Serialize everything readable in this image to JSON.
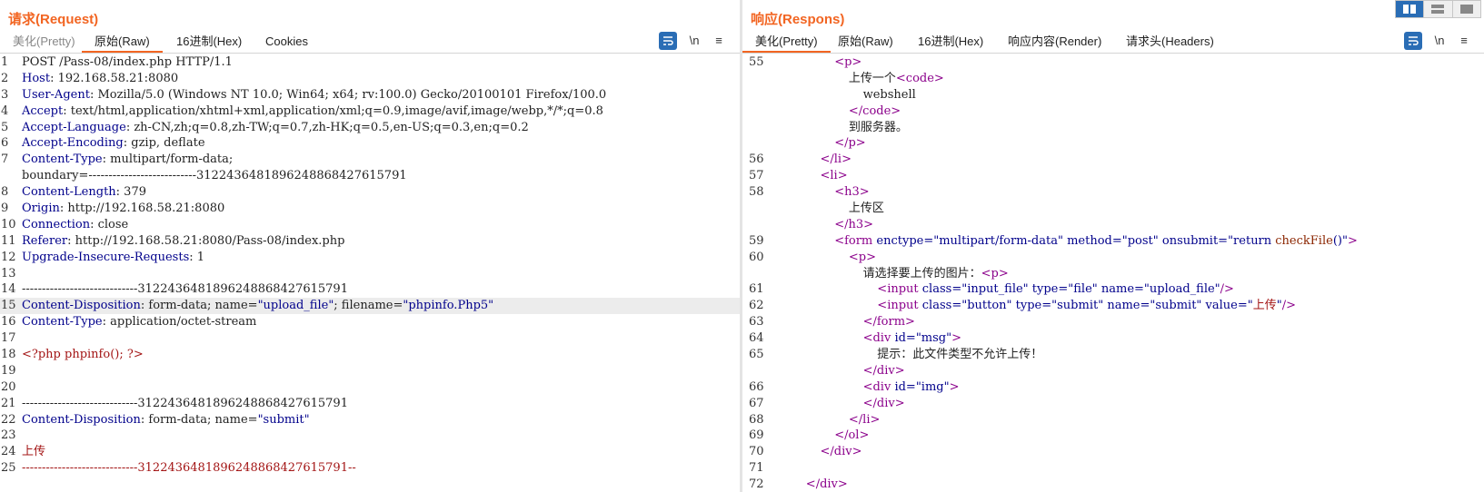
{
  "request": {
    "title": "请求(Request)",
    "tabs": [
      "美化(Pretty)",
      "原始(Raw)",
      "16进制(Hex)",
      "Cookies"
    ],
    "active_tab": "原始(Raw)",
    "newline_label": "\\n",
    "menu_label": "≡",
    "lines": [
      {
        "n": "1",
        "segs": [
          [
            "",
            "POST /Pass-08/index.php HTTP/1.1"
          ]
        ]
      },
      {
        "n": "2",
        "segs": [
          [
            "hdr",
            "Host"
          ],
          [
            "",
            ": 192.168.58.21:8080"
          ]
        ]
      },
      {
        "n": "3",
        "segs": [
          [
            "hdr",
            "User-Agent"
          ],
          [
            "",
            ": Mozilla/5.0 (Windows NT 10.0; Win64; x64; rv:100.0) Gecko/20100101 Firefox/100.0"
          ]
        ]
      },
      {
        "n": "4",
        "segs": [
          [
            "hdr",
            "Accept"
          ],
          [
            "",
            ": text/html,application/xhtml+xml,application/xml;q=0.9,image/avif,image/webp,*/*;q=0.8"
          ]
        ]
      },
      {
        "n": "5",
        "segs": [
          [
            "hdr",
            "Accept-Language"
          ],
          [
            "",
            ": zh-CN,zh;q=0.8,zh-TW;q=0.7,zh-HK;q=0.5,en-US;q=0.3,en;q=0.2"
          ]
        ]
      },
      {
        "n": "6",
        "segs": [
          [
            "hdr",
            "Accept-Encoding"
          ],
          [
            "",
            ": gzip, deflate"
          ]
        ]
      },
      {
        "n": "7",
        "segs": [
          [
            "hdr",
            "Content-Type"
          ],
          [
            "",
            ": multipart/form-data;"
          ]
        ]
      },
      {
        "n": "",
        "segs": [
          [
            "",
            "boundary=---------------------------312243648189624886842761579 1"
          ]
        ]
      },
      {
        "n": "8",
        "segs": [
          [
            "hdr",
            "Content-Length"
          ],
          [
            "",
            ": 379"
          ]
        ]
      },
      {
        "n": "9",
        "segs": [
          [
            "hdr",
            "Origin"
          ],
          [
            "",
            ": http://192.168.58.21:8080"
          ]
        ]
      },
      {
        "n": "10",
        "segs": [
          [
            "hdr",
            "Connection"
          ],
          [
            "",
            ": close"
          ]
        ]
      },
      {
        "n": "11",
        "segs": [
          [
            "hdr",
            "Referer"
          ],
          [
            "",
            ": http://192.168.58.21:8080/Pass-08/index.php"
          ]
        ]
      },
      {
        "n": "12",
        "segs": [
          [
            "hdr",
            "Upgrade-Insecure-Requests"
          ],
          [
            "",
            ": 1"
          ]
        ]
      },
      {
        "n": "13",
        "segs": []
      },
      {
        "n": "14",
        "segs": [
          [
            "",
            "-----------------------------3122436481896248868427615791"
          ]
        ]
      },
      {
        "n": "15",
        "hl": true,
        "segs": [
          [
            "hdr",
            "Content-Disposition"
          ],
          [
            "",
            ": form-data; name="
          ],
          [
            "str",
            "\"upload_file\""
          ],
          [
            "",
            "; filename="
          ],
          [
            "str",
            "\"phpinfo.Php5\""
          ]
        ]
      },
      {
        "n": "16",
        "segs": [
          [
            "hdr",
            "Content-Type"
          ],
          [
            "",
            ": application/octet-stream"
          ]
        ]
      },
      {
        "n": "17",
        "segs": []
      },
      {
        "n": "18",
        "segs": [
          [
            "red",
            "<?php phpinfo(); ?>"
          ]
        ]
      },
      {
        "n": "19",
        "segs": []
      },
      {
        "n": "20",
        "segs": []
      },
      {
        "n": "21",
        "segs": [
          [
            "",
            "-----------------------------3122436481896248868427615791"
          ]
        ]
      },
      {
        "n": "22",
        "segs": [
          [
            "hdr",
            "Content-Disposition"
          ],
          [
            "",
            ": form-data; name="
          ],
          [
            "str",
            "\"submit\""
          ]
        ]
      },
      {
        "n": "23",
        "segs": []
      },
      {
        "n": "24",
        "segs": [
          [
            "red",
            "上传"
          ]
        ]
      },
      {
        "n": "25",
        "segs": [
          [
            "red",
            "-----------------------------3122436481896248868427615791--"
          ]
        ]
      }
    ]
  },
  "response": {
    "title": "响应(Respons)",
    "tabs": [
      "美化(Pretty)",
      "原始(Raw)",
      "16进制(Hex)",
      "响应内容(Render)",
      "请求头(Headers)"
    ],
    "active_tab": "美化(Pretty)",
    "newline_label": "\\n",
    "menu_label": "≡",
    "lines": [
      {
        "n": "55",
        "i": 6,
        "segs": [
          [
            "tag",
            "<p>"
          ]
        ]
      },
      {
        "n": "",
        "i": 7,
        "segs": [
          [
            "",
            "上传一个"
          ],
          [
            "tag",
            "<code>"
          ]
        ]
      },
      {
        "n": "",
        "i": 8,
        "segs": [
          [
            "",
            "webshell"
          ]
        ]
      },
      {
        "n": "",
        "i": 7,
        "segs": [
          [
            "tag",
            "</code>"
          ]
        ]
      },
      {
        "n": "",
        "i": 7,
        "segs": [
          [
            "",
            "到服务器。"
          ]
        ]
      },
      {
        "n": "",
        "i": 6,
        "segs": [
          [
            "tag",
            "</p>"
          ]
        ]
      },
      {
        "n": "56",
        "i": 5,
        "segs": [
          [
            "tag",
            "</li>"
          ]
        ]
      },
      {
        "n": "57",
        "i": 5,
        "segs": [
          [
            "tag",
            "<li>"
          ]
        ]
      },
      {
        "n": "58",
        "i": 6,
        "segs": [
          [
            "tag",
            "<h3>"
          ]
        ]
      },
      {
        "n": "",
        "i": 7,
        "segs": [
          [
            "",
            "上传区"
          ]
        ]
      },
      {
        "n": "",
        "i": 6,
        "segs": [
          [
            "tag",
            "</h3>"
          ]
        ]
      },
      {
        "n": "59",
        "i": 6,
        "segs": [
          [
            "tag",
            "<form "
          ],
          [
            "attr",
            "enctype="
          ],
          [
            "str",
            "\"multipart/form-data\""
          ],
          [
            "attr",
            " method="
          ],
          [
            "str",
            "\"post\""
          ],
          [
            "attr",
            " onsubmit="
          ],
          [
            "str",
            "\"return "
          ],
          [
            "brown",
            "checkFile"
          ],
          [
            "str",
            "()\""
          ],
          [
            "tag",
            ">"
          ]
        ]
      },
      {
        "n": "60",
        "i": 7,
        "segs": [
          [
            "tag",
            "<p>"
          ]
        ]
      },
      {
        "n": "",
        "i": 8,
        "segs": [
          [
            "",
            "请选择要上传的图片："
          ],
          [
            "tag",
            "<p>"
          ]
        ]
      },
      {
        "n": "61",
        "i": 9,
        "segs": [
          [
            "tag",
            "<input "
          ],
          [
            "attr",
            "class="
          ],
          [
            "str",
            "\"input_file\""
          ],
          [
            "attr",
            " type="
          ],
          [
            "str",
            "\"file\""
          ],
          [
            "attr",
            " name="
          ],
          [
            "str",
            "\"upload_file\""
          ],
          [
            "tag",
            "/>"
          ]
        ]
      },
      {
        "n": "62",
        "i": 9,
        "segs": [
          [
            "tag",
            "<input "
          ],
          [
            "attr",
            "class="
          ],
          [
            "str",
            "\"button\""
          ],
          [
            "attr",
            " type="
          ],
          [
            "str",
            "\"submit\""
          ],
          [
            "attr",
            " name="
          ],
          [
            "str",
            "\"submit\""
          ],
          [
            "attr",
            " value="
          ],
          [
            "str",
            "\""
          ],
          [
            "red",
            "上传"
          ],
          [
            "str",
            "\""
          ],
          [
            "tag",
            "/>"
          ]
        ]
      },
      {
        "n": "63",
        "i": 8,
        "segs": [
          [
            "tag",
            "</form>"
          ]
        ]
      },
      {
        "n": "64",
        "i": 8,
        "segs": [
          [
            "tag",
            "<div "
          ],
          [
            "attr",
            "id="
          ],
          [
            "str",
            "\"msg\""
          ],
          [
            "tag",
            ">"
          ]
        ]
      },
      {
        "n": "65",
        "i": 9,
        "segs": [
          [
            "",
            "提示：此文件类型不允许上传！"
          ]
        ]
      },
      {
        "n": "",
        "i": 8,
        "segs": [
          [
            "tag",
            "</div>"
          ]
        ]
      },
      {
        "n": "66",
        "i": 8,
        "segs": [
          [
            "tag",
            "<div "
          ],
          [
            "attr",
            "id="
          ],
          [
            "str",
            "\"img\""
          ],
          [
            "tag",
            ">"
          ]
        ]
      },
      {
        "n": "67",
        "i": 8,
        "segs": [
          [
            "tag",
            "</div>"
          ]
        ]
      },
      {
        "n": "68",
        "i": 7,
        "segs": [
          [
            "tag",
            "</li>"
          ]
        ]
      },
      {
        "n": "69",
        "i": 6,
        "segs": [
          [
            "tag",
            "</ol>"
          ]
        ]
      },
      {
        "n": "70",
        "i": 5,
        "segs": [
          [
            "tag",
            "</div>"
          ]
        ]
      },
      {
        "n": "71",
        "i": 0,
        "segs": []
      },
      {
        "n": "72",
        "i": 4,
        "segs": [
          [
            "tag",
            "</div>"
          ]
        ]
      }
    ]
  }
}
